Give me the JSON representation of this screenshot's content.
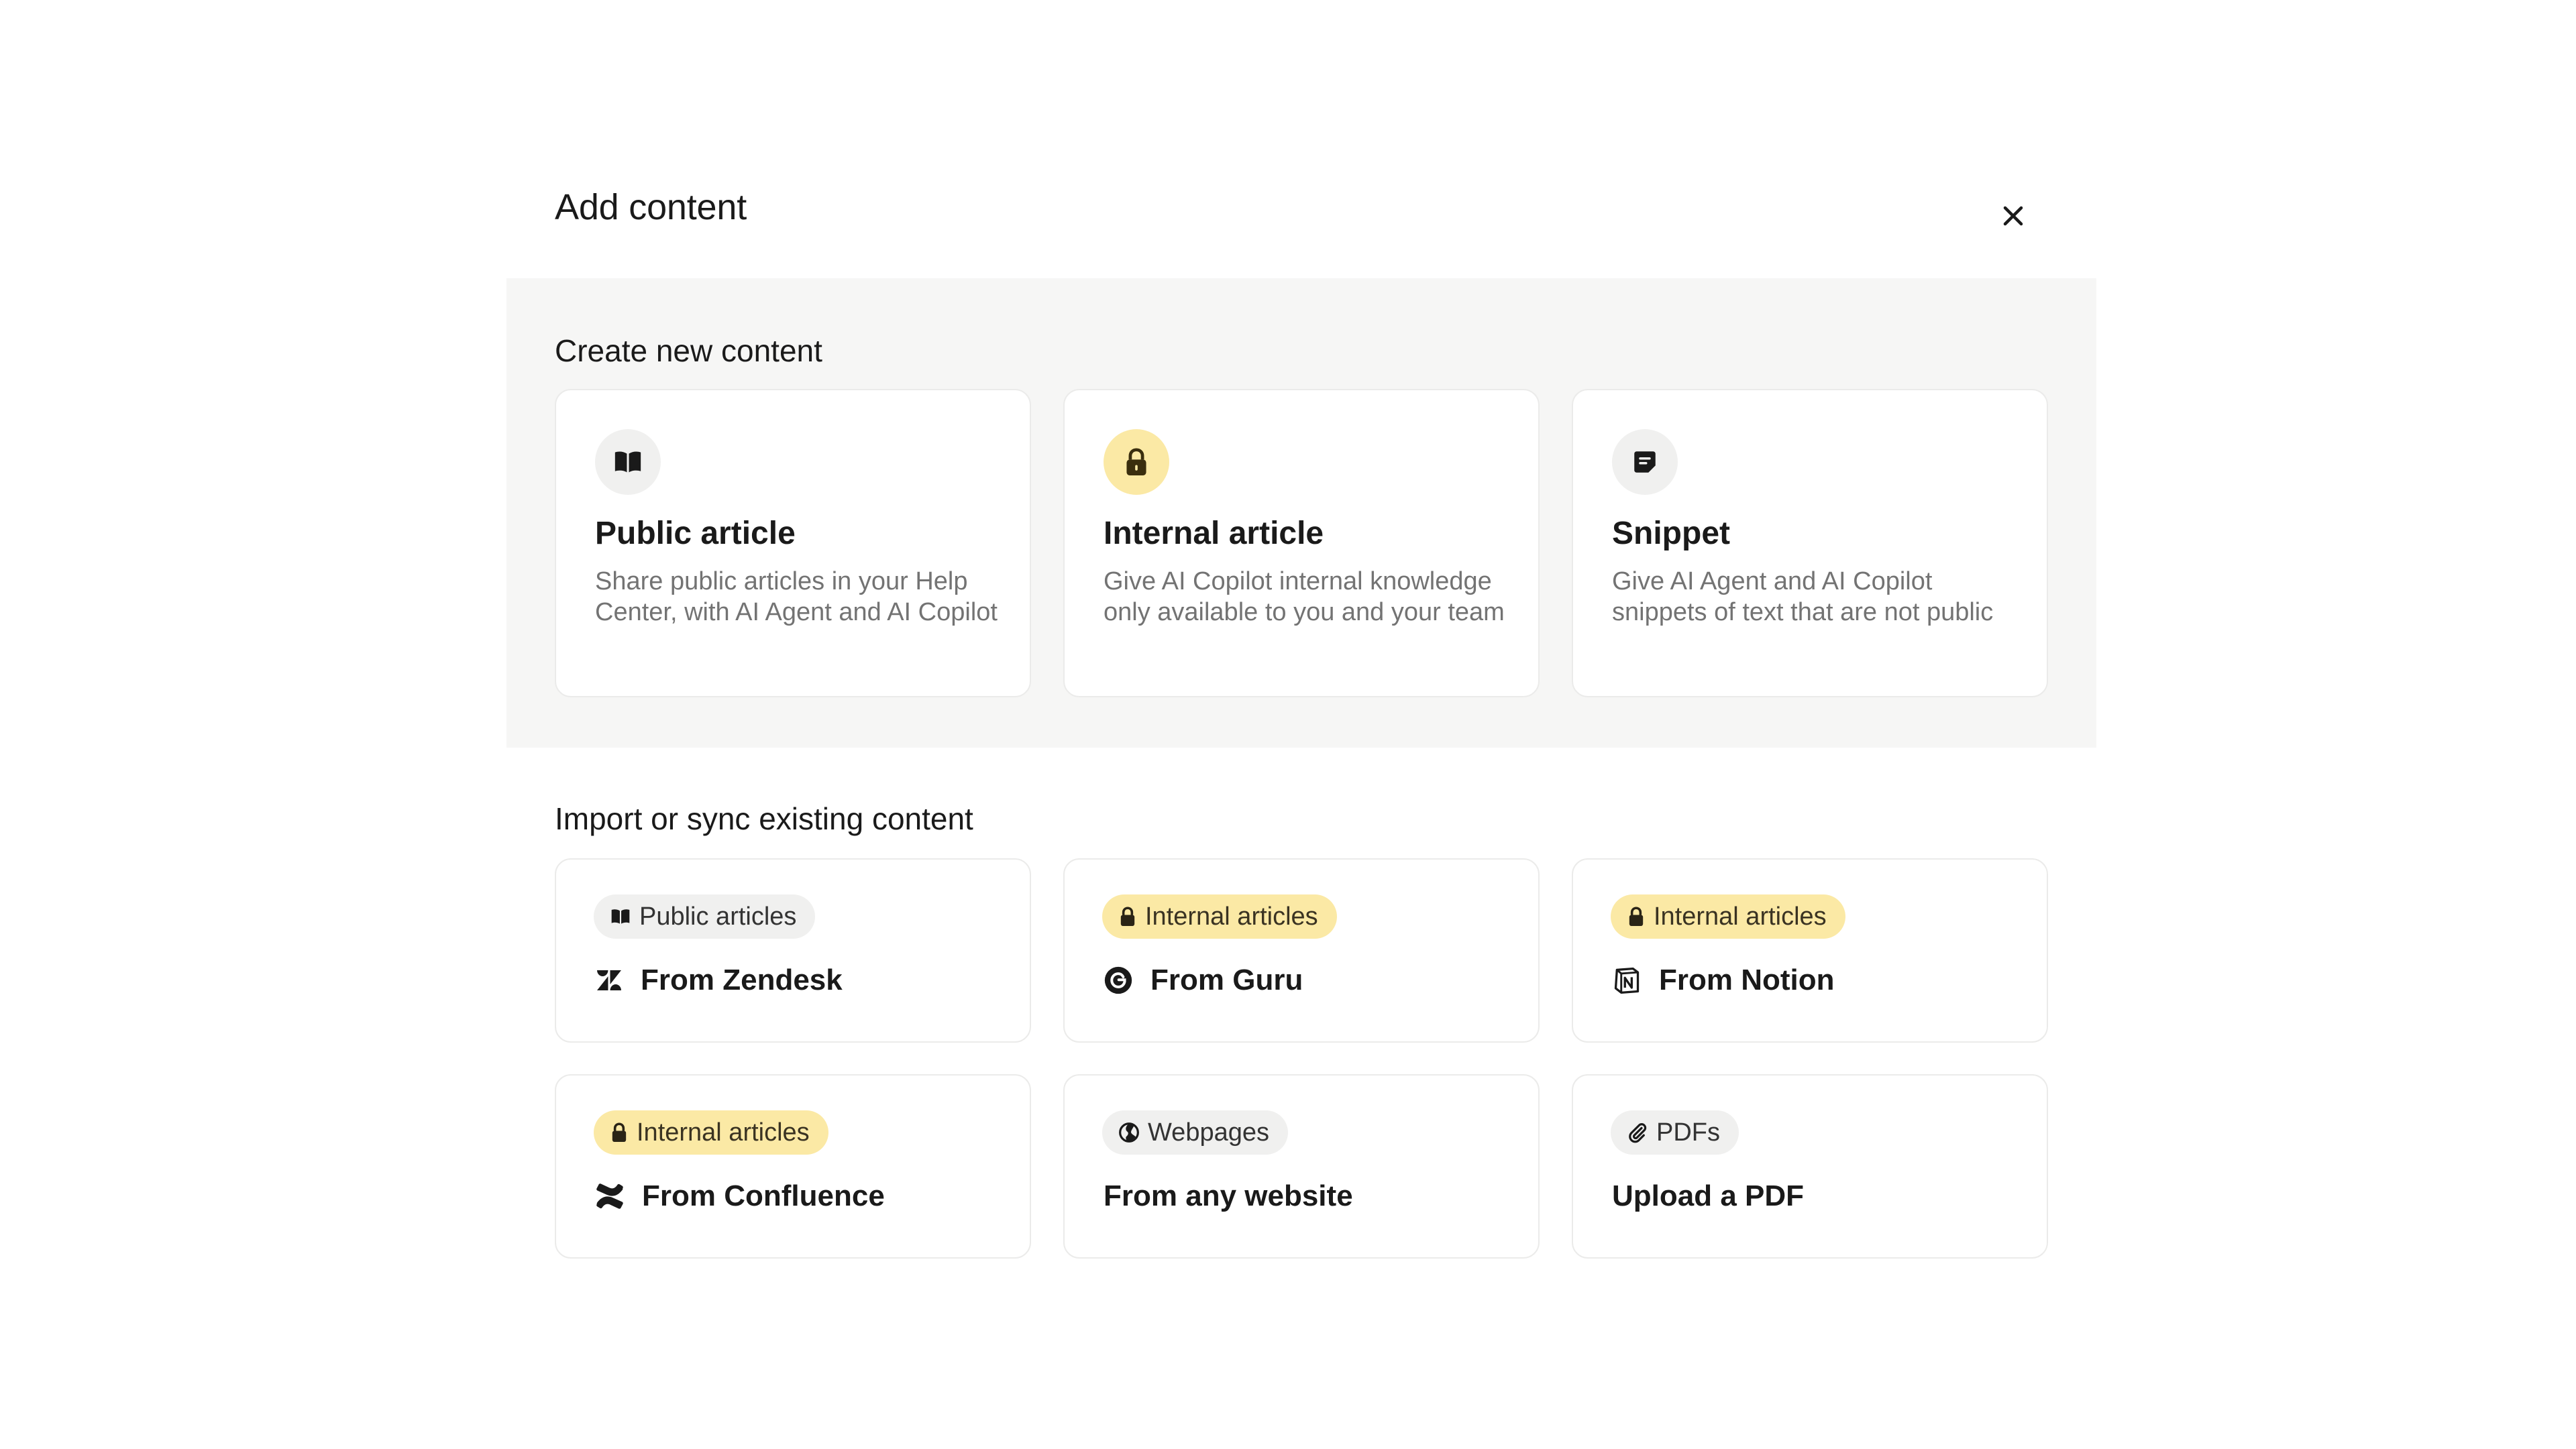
{
  "modal": {
    "title": "Add content"
  },
  "create": {
    "section_title": "Create new content",
    "cards": [
      {
        "title": "Public article",
        "description": "Share public articles in your Help Center, with AI Agent and AI Copilot",
        "icon": "book-icon"
      },
      {
        "title": "Internal article",
        "description": "Give AI Copilot internal knowledge only available to you and your team",
        "icon": "lock-icon"
      },
      {
        "title": "Snippet",
        "description": "Give AI Agent and AI Copilot snippets of text that are not public",
        "icon": "note-icon"
      }
    ]
  },
  "import": {
    "section_title": "Import or sync existing content",
    "cards": [
      {
        "badge": "Public articles",
        "badge_icon": "book-icon",
        "label": "From Zendesk",
        "source_icon": "zendesk-icon"
      },
      {
        "badge": "Internal articles",
        "badge_icon": "lock-icon",
        "label": "From Guru",
        "source_icon": "guru-icon"
      },
      {
        "badge": "Internal articles",
        "badge_icon": "lock-icon",
        "label": "From Notion",
        "source_icon": "notion-icon"
      },
      {
        "badge": "Internal articles",
        "badge_icon": "lock-icon",
        "label": "From Confluence",
        "source_icon": "confluence-icon"
      },
      {
        "badge": "Webpages",
        "badge_icon": "globe-icon",
        "label": "From any website",
        "source_icon": ""
      },
      {
        "badge": "PDFs",
        "badge_icon": "paperclip-icon",
        "label": "Upload a PDF",
        "source_icon": ""
      }
    ]
  },
  "colors": {
    "accent_yellow": "#fbe9a5",
    "section_bg": "#f6f6f5",
    "card_border": "#ebebea",
    "text_primary": "#1a1a1a",
    "text_muted": "#737373"
  }
}
